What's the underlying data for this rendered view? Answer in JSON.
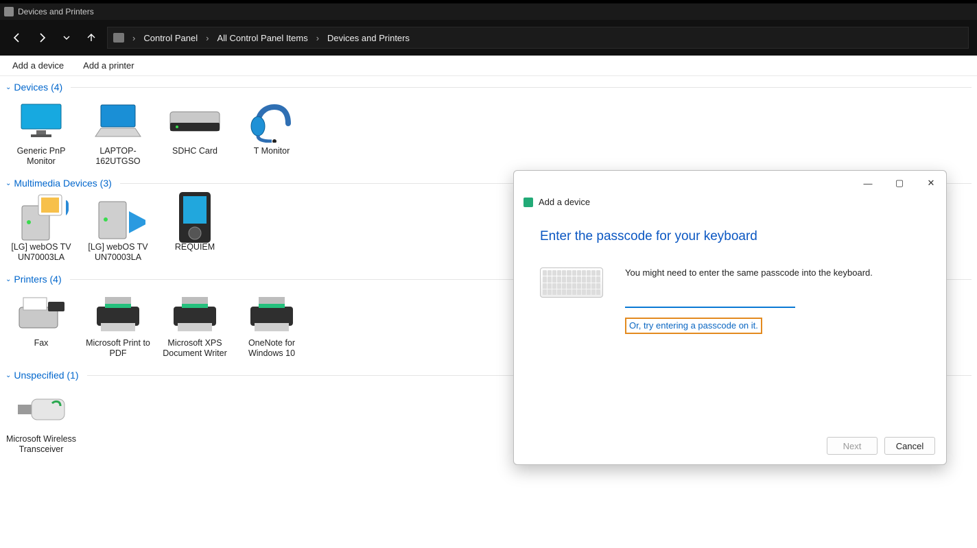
{
  "window": {
    "title": "Devices and Printers"
  },
  "breadcrumb": {
    "seg1": "Control Panel",
    "seg2": "All Control Panel Items",
    "seg3": "Devices and Printers"
  },
  "cmdbar": {
    "add_device": "Add a device",
    "add_printer": "Add a printer"
  },
  "groups": {
    "devices": {
      "header": "Devices (4)",
      "items": [
        {
          "label": "Generic PnP Monitor"
        },
        {
          "label": "LAPTOP-162UTGSO"
        },
        {
          "label": "SDHC Card"
        },
        {
          "label": "T Monitor"
        }
      ]
    },
    "multimedia": {
      "header": "Multimedia Devices (3)",
      "items": [
        {
          "label": "[LG] webOS TV UN70003LA"
        },
        {
          "label": "[LG] webOS TV UN70003LA"
        },
        {
          "label": "REQUIEM"
        }
      ]
    },
    "printers": {
      "header": "Printers (4)",
      "items": [
        {
          "label": "Fax"
        },
        {
          "label": "Microsoft Print to PDF"
        },
        {
          "label": "Microsoft XPS Document Writer"
        },
        {
          "label": "OneNote for Windows 10"
        }
      ]
    },
    "unspecified": {
      "header": "Unspecified (1)",
      "items": [
        {
          "label": "Microsoft Wireless Transceiver"
        }
      ]
    }
  },
  "dialog": {
    "caption": "Add a device",
    "heading": "Enter the passcode for your keyboard",
    "hint": "You might need to enter the same passcode into the keyboard.",
    "passcode_value": "",
    "alt_link": "Or, try entering a passcode on it.",
    "next": "Next",
    "cancel": "Cancel"
  }
}
